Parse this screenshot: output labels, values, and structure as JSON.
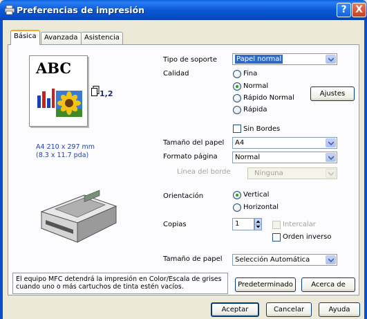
{
  "window": {
    "title": "Preferencias de impresión",
    "help_button": "?",
    "close_button": "X"
  },
  "tabs": [
    {
      "label": "Básica",
      "active": true
    },
    {
      "label": "Avanzada",
      "active": false
    },
    {
      "label": "Asistencia",
      "active": false
    }
  ],
  "preview": {
    "sample_text": "ABC",
    "copies_label": "1,2",
    "paper_size_line1": "A4 210 x 297 mm",
    "paper_size_line2": "(8.3 x 11.7 pda)"
  },
  "media_type": {
    "label": "Tipo de soporte",
    "value": "Papel normal"
  },
  "quality": {
    "label": "Calidad",
    "options": [
      "Fina",
      "Normal",
      "Rápido Normal",
      "Rápida"
    ],
    "selected": "Normal",
    "settings_button": "Ajustes"
  },
  "borderless": {
    "label": "Sin Bordes",
    "checked": false
  },
  "paper_size": {
    "label": "Tamaño del papel",
    "value": "A4"
  },
  "page_format": {
    "label": "Formato página",
    "value": "Normal"
  },
  "border_line": {
    "label": "Línea del borde",
    "value": "Ninguna",
    "disabled": true
  },
  "orientation": {
    "label": "Orientación",
    "options": [
      "Vertical",
      "Horizontal"
    ],
    "selected": "Vertical"
  },
  "copies": {
    "label": "Copias",
    "value": "1",
    "collate_label": "Intercalar",
    "reverse_label": "Orden inverso"
  },
  "paper_source": {
    "label": "Tamaño de papel",
    "value": "Selección Automática"
  },
  "info_text_line1": "El equipo MFC detendrá la impresión en Color/Escala de grises",
  "info_text_line2": "cuando uno o más cartuchos de tinta estén vacíos.",
  "buttons": {
    "default": "Predeterminado",
    "about": "Acerca de",
    "ok": "Aceptar",
    "cancel": "Cancelar",
    "help": "Ayuda"
  },
  "colors": {
    "titlebar": "#0a58d6",
    "accent_tab": "#f5a623",
    "selection": "#316ac5",
    "link_text": "#1f3fa8"
  },
  "icons": [
    "printer-app-icon",
    "sunflower-image-icon",
    "bar-chart-icon",
    "copies-icon",
    "mfc-printer-icon",
    "dropdown-arrow-icon"
  ]
}
